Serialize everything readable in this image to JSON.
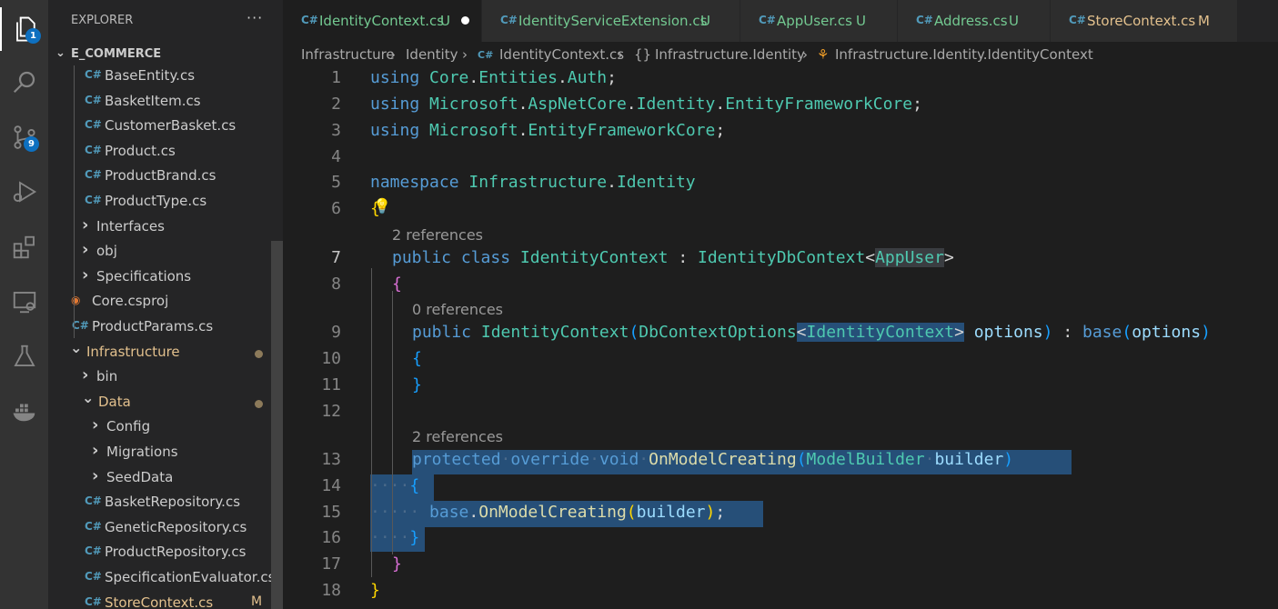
{
  "activity_bar": {
    "explorer_badge": "1",
    "source_control_badge": "9"
  },
  "sidebar": {
    "title": "EXPLORER",
    "more": "···",
    "section": "E_COMMERCE",
    "items": [
      {
        "label": "BaseEntity.cs",
        "type": "cs"
      },
      {
        "label": "BasketItem.cs",
        "type": "cs"
      },
      {
        "label": "CustomerBasket.cs",
        "type": "cs"
      },
      {
        "label": "Product.cs",
        "type": "cs"
      },
      {
        "label": "ProductBrand.cs",
        "type": "cs"
      },
      {
        "label": "ProductType.cs",
        "type": "cs"
      },
      {
        "label": "Interfaces",
        "type": "folder"
      },
      {
        "label": "obj",
        "type": "folder"
      },
      {
        "label": "Specifications",
        "type": "folder"
      },
      {
        "label": "Core.csproj",
        "type": "rss"
      },
      {
        "label": "ProductParams.cs",
        "type": "cs"
      },
      {
        "label": "Infrastructure",
        "type": "folder-open",
        "modified": true
      },
      {
        "label": "bin",
        "type": "folder"
      },
      {
        "label": "Data",
        "type": "folder-open",
        "modified": true
      },
      {
        "label": "Config",
        "type": "folder"
      },
      {
        "label": "Migrations",
        "type": "folder"
      },
      {
        "label": "SeedData",
        "type": "folder"
      },
      {
        "label": "BasketRepository.cs",
        "type": "cs"
      },
      {
        "label": "GeneticRepository.cs",
        "type": "cs"
      },
      {
        "label": "ProductRepository.cs",
        "type": "cs"
      },
      {
        "label": "SpecificationEvaluator.cs",
        "type": "cs"
      },
      {
        "label": "StoreContext.cs",
        "type": "cs",
        "status": "M"
      }
    ]
  },
  "tabs": [
    {
      "label": "IdentityContext.cs",
      "status": "U",
      "active": true,
      "dirty": true
    },
    {
      "label": "IdentityServiceExtension.cs",
      "status": "U"
    },
    {
      "label": "AppUser.cs",
      "status": "U"
    },
    {
      "label": "Address.cs",
      "status": "U"
    },
    {
      "label": "StoreContext.cs",
      "status": "M"
    }
  ],
  "breadcrumbs": [
    "Infrastructure",
    "Identity",
    "IdentityContext.cs",
    "Infrastructure.Identity",
    "Infrastructure.Identity.IdentityContext"
  ],
  "editor": {
    "line_numbers": [
      "1",
      "2",
      "3",
      "4",
      "5",
      "6",
      "7",
      "8",
      "9",
      "10",
      "11",
      "12",
      "13",
      "14",
      "15",
      "16",
      "17",
      "18"
    ],
    "current_line": "7",
    "code_lens": [
      "2 references",
      "0 references",
      "2 references"
    ],
    "code": {
      "l1": [
        "using",
        "Core",
        ".",
        "Entities",
        ".",
        "Auth",
        ";"
      ],
      "l2": [
        "using",
        "Microsoft",
        ".",
        "AspNetCore",
        ".",
        "Identity",
        ".",
        "EntityFrameworkCore",
        ";"
      ],
      "l3": [
        "using",
        "Microsoft",
        ".",
        "EntityFrameworkCore",
        ";"
      ],
      "l5": [
        "namespace",
        "Infrastructure",
        ".",
        "Identity"
      ],
      "l6": [
        "{"
      ],
      "l7": [
        "public",
        "class",
        "IdentityContext",
        ":",
        "IdentityDbContext",
        "<",
        "AppUser",
        ">"
      ],
      "l8": [
        "{"
      ],
      "l9": [
        "public",
        "IdentityContext",
        "(",
        "DbContextOptions",
        "<",
        "IdentityContext",
        ">",
        "options",
        ")",
        ":",
        "base",
        "(",
        "options",
        ")"
      ],
      "l10": [
        "{"
      ],
      "l11": [
        "}"
      ],
      "l13": [
        "protected",
        "override",
        "void",
        "OnModelCreating",
        "(",
        "ModelBuilder",
        "builder",
        ")"
      ],
      "l14": [
        "{"
      ],
      "l15": [
        "base",
        ".",
        "OnModelCreating",
        "(",
        "builder",
        ")",
        ";"
      ],
      "l16": [
        "}"
      ],
      "l17": [
        "}"
      ],
      "l18": [
        "}"
      ]
    }
  },
  "colors": {
    "keyword": "#569cd6",
    "type": "#4ec9b0",
    "function": "#dcdcaa",
    "parameter": "#9cdcfe",
    "selection": "#264f78",
    "untracked": "#73c991",
    "modified": "#e2c08d"
  }
}
